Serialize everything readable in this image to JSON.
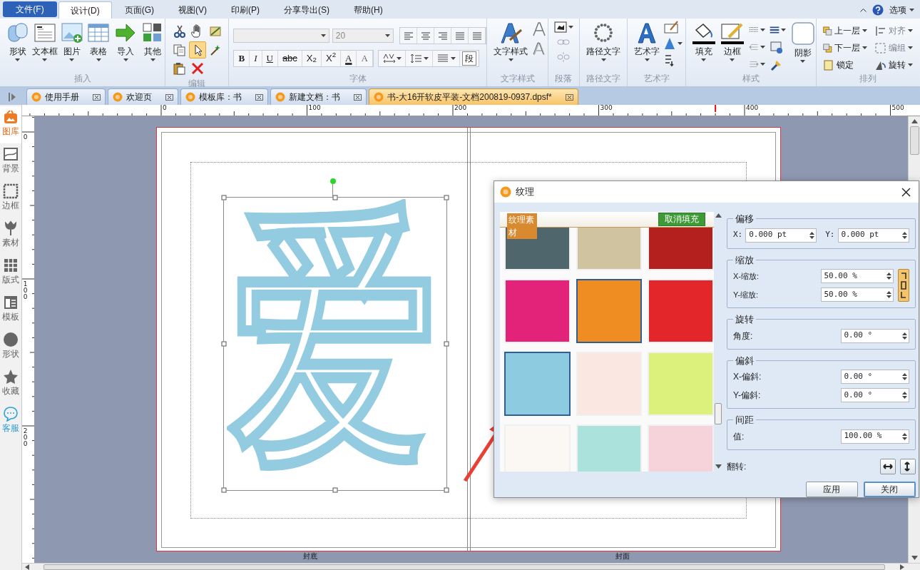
{
  "menu_tabs": [
    {
      "label": "文件(F)",
      "kind": "file",
      "selected": false
    },
    {
      "label": "设计(D)",
      "kind": "tab",
      "selected": true
    },
    {
      "label": "页面(G)",
      "kind": "tab",
      "selected": false
    },
    {
      "label": "视图(V)",
      "kind": "tab",
      "selected": false
    },
    {
      "label": "印刷(P)",
      "kind": "tab",
      "selected": false
    },
    {
      "label": "分享导出(S)",
      "kind": "tab",
      "selected": false
    },
    {
      "label": "帮助(H)",
      "kind": "tab",
      "selected": false
    }
  ],
  "options_menu": "选项",
  "ribbon": {
    "insert": {
      "label": "插入",
      "buttons": [
        "形状",
        "文本框",
        "图片",
        "表格",
        "导入",
        "其他"
      ]
    },
    "edit": {
      "label": "编辑"
    },
    "font": {
      "label": "字体",
      "size": "20",
      "format_buttons": [
        "B",
        "I",
        "U",
        "abc",
        "X$_{2}$",
        "X$^{2}$",
        "A",
        "A"
      ],
      "paragraph_button": "段"
    },
    "text_style": {
      "label": "文字样式",
      "button": "文字样式"
    },
    "paragraph": {
      "label": "段落"
    },
    "path_text": {
      "label": "路径文字",
      "button": "路径文字"
    },
    "art_text": {
      "label": "艺术字",
      "button": "艺术字"
    },
    "style": {
      "label": "样式",
      "buttons": [
        "填充",
        "边框",
        "阴影"
      ]
    },
    "arrange": {
      "label": "排列",
      "items": [
        {
          "label": "上一层",
          "disabled": false
        },
        {
          "label": "对齐",
          "disabled": true
        },
        {
          "label": "下一层",
          "disabled": false
        },
        {
          "label": "编组",
          "disabled": true
        },
        {
          "label": "锁定",
          "disabled": false
        },
        {
          "label": "旋转",
          "disabled": false
        }
      ]
    }
  },
  "doc_tabs": [
    {
      "label": "使用手册",
      "selected": false
    },
    {
      "label": "欢迎页",
      "selected": false
    },
    {
      "label": "模板库：书",
      "selected": false
    },
    {
      "label": "新建文档：书",
      "selected": false
    },
    {
      "label": "书-大16开软皮平装-文档200819-0937.dpsf*",
      "selected": true
    }
  ],
  "rulers": {
    "horizontal": [
      "0",
      "100",
      "200",
      "300",
      "400",
      "500"
    ],
    "vertical": [
      "0",
      "100",
      "200"
    ]
  },
  "sidebar": [
    {
      "label": "图库",
      "kind": "gallery",
      "selected": true
    },
    {
      "label": "背景",
      "kind": "background",
      "selected": false
    },
    {
      "label": "边框",
      "kind": "border",
      "selected": false
    },
    {
      "label": "素材",
      "kind": "material",
      "selected": false
    },
    {
      "label": "版式",
      "kind": "layout",
      "selected": false
    },
    {
      "label": "模板",
      "kind": "template",
      "selected": false
    },
    {
      "label": "形状",
      "kind": "shape",
      "selected": false
    },
    {
      "label": "收藏",
      "kind": "favorite",
      "selected": false
    },
    {
      "label": "客服",
      "kind": "chat",
      "selected": false
    }
  ],
  "canvas": {
    "glyph": "爱",
    "page_labels": [
      "封底",
      "封面"
    ]
  },
  "dialog": {
    "title": "纹理",
    "category": "纹理素材",
    "clear_fill": "取消填充",
    "textures": [
      {
        "color": "#4f666c",
        "selected": false
      },
      {
        "color": "#cfc3a0",
        "selected": false
      },
      {
        "color": "#b3201e",
        "selected": false
      },
      {
        "color": "#e3237a",
        "selected": false
      },
      {
        "color": "#ef8d22",
        "selected": true
      },
      {
        "color": "#e2262a",
        "selected": false
      },
      {
        "color": "#8ccbe0",
        "selected": true
      },
      {
        "color": "#fbe7e2",
        "selected": false
      },
      {
        "color": "#dcf07c",
        "selected": false
      },
      {
        "color": "#fbf7f2",
        "selected": false
      },
      {
        "color": "#abe2db",
        "selected": false
      },
      {
        "color": "#f6d3da",
        "selected": false
      }
    ],
    "groups": [
      {
        "title": "偏移",
        "kind": "pair",
        "fields": [
          {
            "label": "X:",
            "value": "0.000 pt"
          },
          {
            "label": "Y:",
            "value": "0.000 pt"
          }
        ]
      },
      {
        "title": "缩放",
        "kind": "linked",
        "linked": true,
        "fields": [
          {
            "label": "X-缩放:",
            "value": "50.00 %"
          },
          {
            "label": "Y-缩放:",
            "value": "50.00 %"
          }
        ]
      },
      {
        "title": "旋转",
        "kind": "rows",
        "fields": [
          {
            "label": "角度:",
            "value": "0.00 °"
          }
        ]
      },
      {
        "title": "偏斜",
        "kind": "rows",
        "fields": [
          {
            "label": "X-偏斜:",
            "value": "0.00 °"
          },
          {
            "label": "Y-偏斜:",
            "value": "0.00 °"
          }
        ]
      },
      {
        "title": "间距",
        "kind": "rows",
        "fields": [
          {
            "label": "值:",
            "value": "100.00 %"
          }
        ]
      }
    ],
    "flip_label": "翻转:",
    "buttons": [
      {
        "label": "应用",
        "default": false
      },
      {
        "label": "关闭",
        "default": true
      }
    ]
  }
}
